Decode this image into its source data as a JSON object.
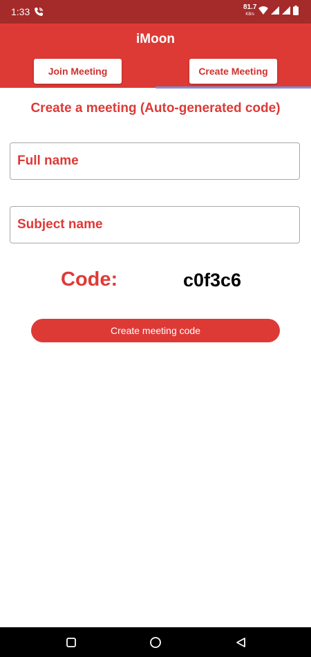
{
  "status_bar": {
    "time": "1:33",
    "speed_value": "81.7",
    "speed_unit": "KB/s",
    "icons": [
      "phone-call-icon",
      "wifi-icon",
      "signal-icon",
      "signal-icon",
      "battery-icon"
    ]
  },
  "app_bar": {
    "title": "iMoon",
    "tabs": [
      {
        "label": "Join Meeting",
        "selected": false
      },
      {
        "label": "Create Meeting",
        "selected": true
      }
    ]
  },
  "create_meeting": {
    "heading": "Create a meeting (Auto-generated code)",
    "full_name": {
      "value": "",
      "placeholder": "Full name"
    },
    "subject_name": {
      "value": "",
      "placeholder": "Subject name"
    },
    "code_label": "Code:",
    "code_value": "c0f3c6",
    "create_button_label": "Create meeting code"
  },
  "colors": {
    "status_bar": "#a52a2a",
    "primary": "#dd3a36",
    "tab_indicator": "#7b8fd6",
    "nav_bar": "#000000"
  },
  "nav_bar": {
    "icons": [
      "recents-icon",
      "home-icon",
      "back-icon"
    ]
  }
}
